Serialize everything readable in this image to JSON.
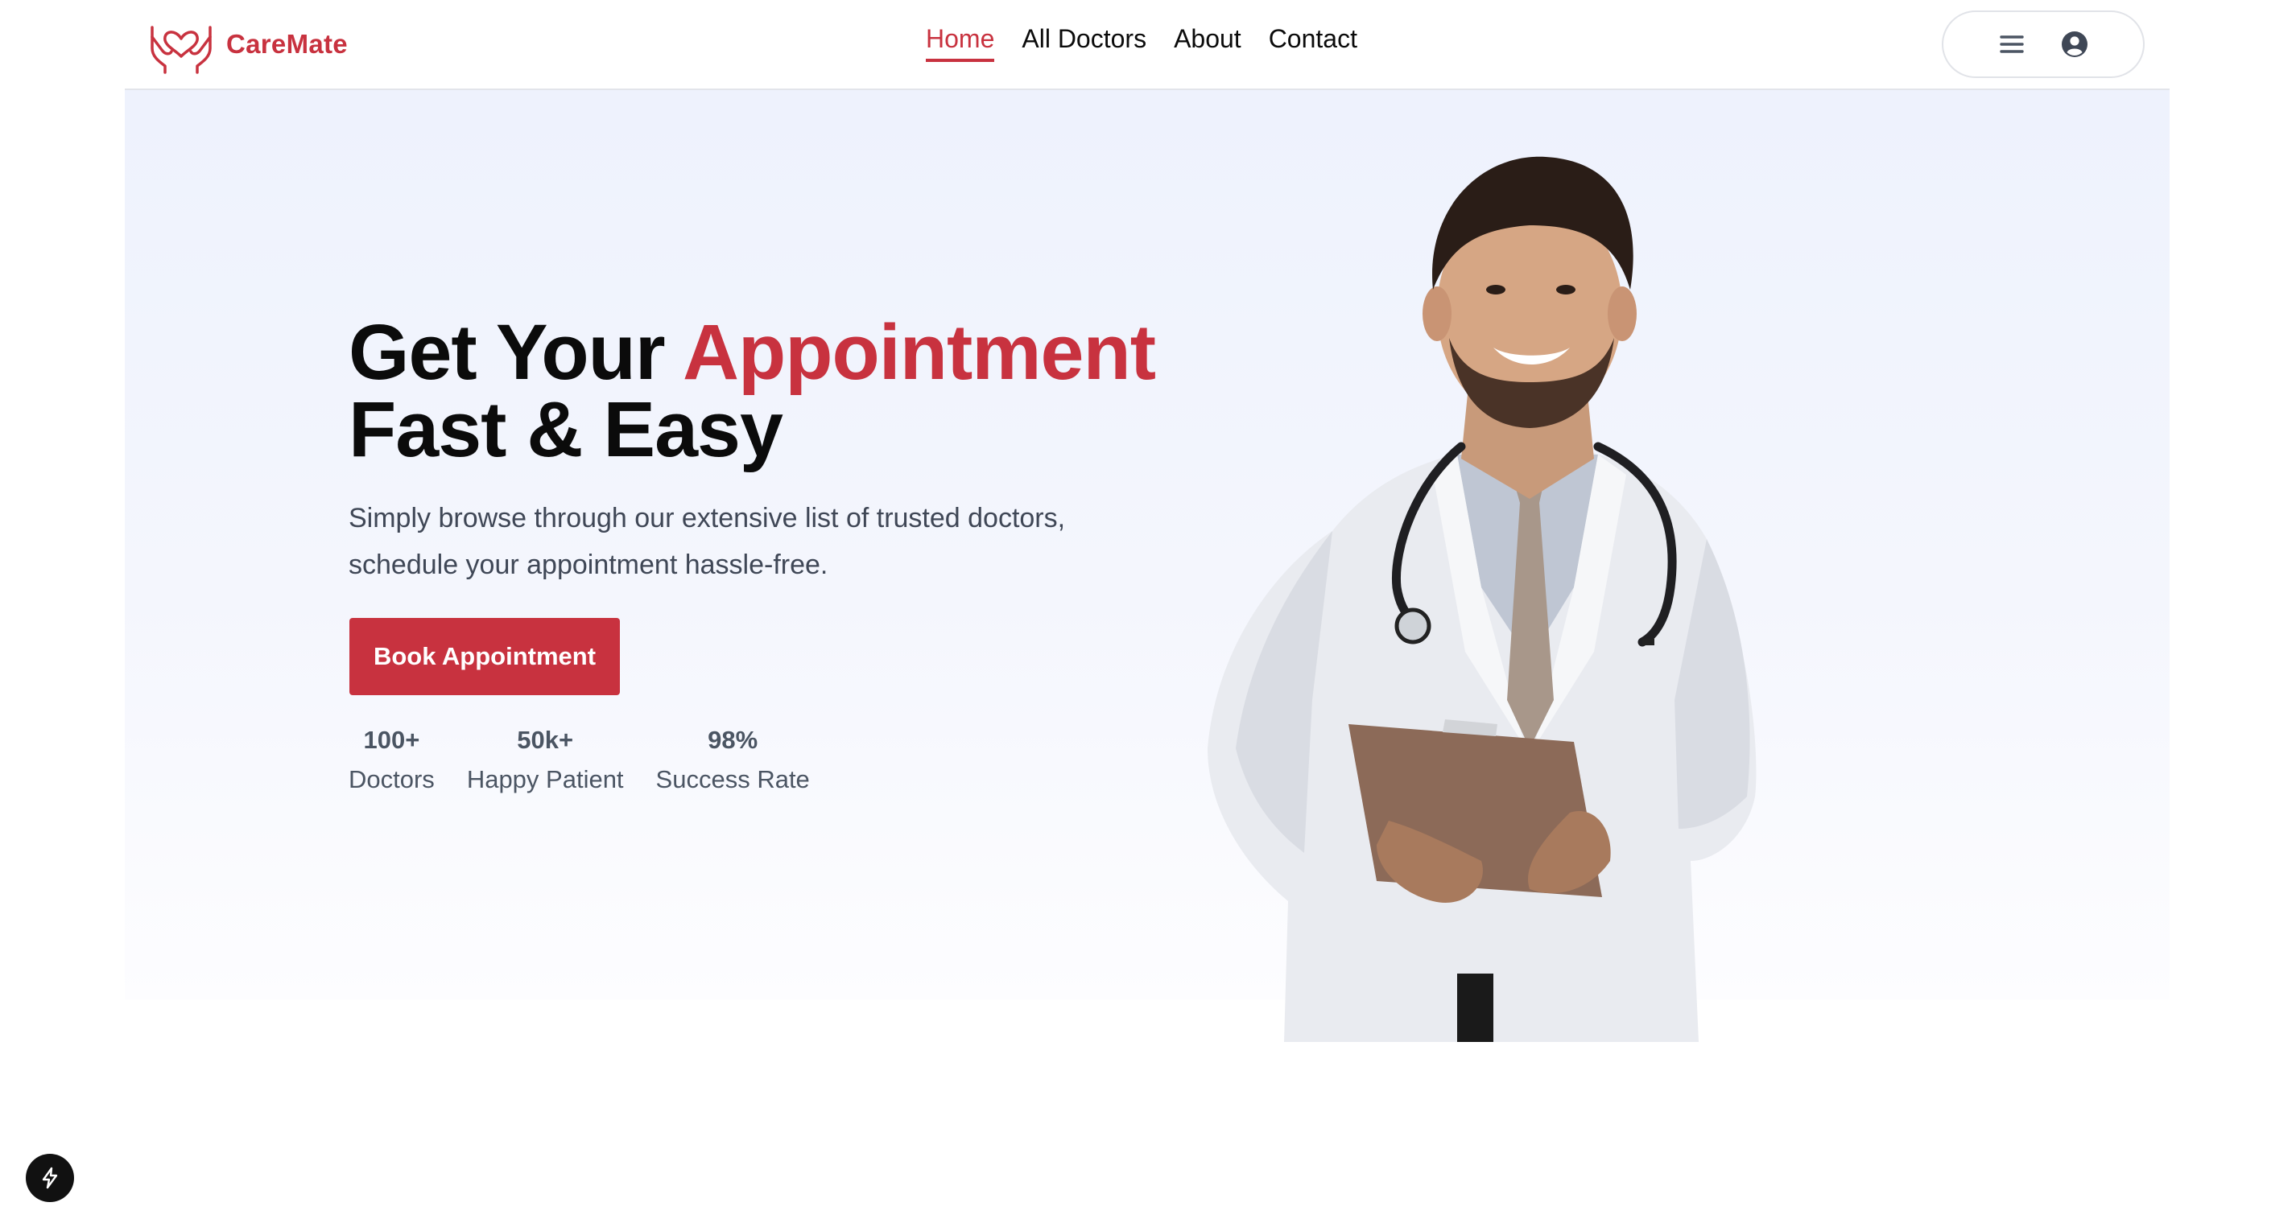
{
  "brand": {
    "name": "CareMate",
    "logo_icon": "hands-heart-icon"
  },
  "nav": {
    "links": [
      {
        "label": "Home",
        "active": true
      },
      {
        "label": "All Doctors",
        "active": false
      },
      {
        "label": "About",
        "active": false
      },
      {
        "label": "Contact",
        "active": false
      }
    ],
    "menu_icon": "hamburger-menu-icon",
    "user_icon": "user-avatar-icon"
  },
  "hero": {
    "title_part1": "Get Your ",
    "title_accent": "Appointment",
    "title_line2": "Fast & Easy",
    "subtitle": "Simply browse through our extensive list of trusted doctors, schedule your appointment hassle-free.",
    "cta_label": "Book Appointment",
    "stats": [
      {
        "value": "100+",
        "label": "Doctors"
      },
      {
        "value": "50k+",
        "label": "Happy Patient"
      },
      {
        "value": "98%",
        "label": "Success Rate"
      }
    ],
    "image_subject": "smiling doctor in white coat with stethoscope holding clipboard"
  },
  "floating_badge": {
    "icon": "lightning-icon"
  },
  "colors": {
    "accent": "#c8323f",
    "text_dark": "#0b0b0b",
    "text_muted": "#4b5563",
    "hero_bg": "#eef2fd"
  }
}
